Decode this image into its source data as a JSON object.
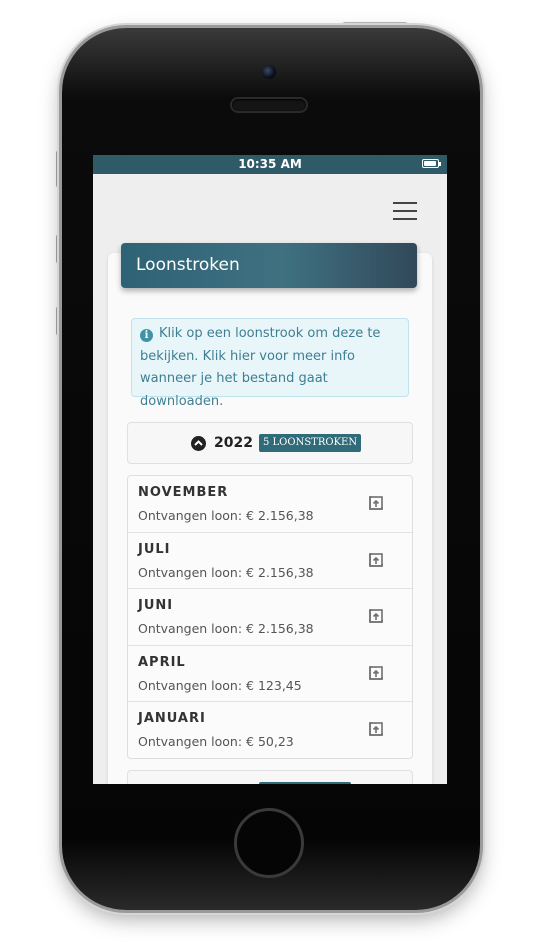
{
  "status_bar": {
    "time": "10:35 AM",
    "battery_level": 0.9
  },
  "header": {
    "menu_icon": "hamburger-menu-icon"
  },
  "card": {
    "title": "Loonstroken"
  },
  "info": {
    "icon": "info-circle-icon",
    "text": "Klik op een loonstrook om deze te bekijken. Klik hier voor meer info wanneer je het bestand gaat downloaden."
  },
  "year_group": {
    "icon": "chevron-up-circle-icon",
    "year": "2022",
    "badge": "5 LOONSTROKEN"
  },
  "payslips": [
    {
      "month": "NOVEMBER",
      "salary": "Ontvangen loon: € 2.156,38",
      "icon": "open-external-icon"
    },
    {
      "month": "JULI",
      "salary": "Ontvangen loon: € 2.156,38",
      "icon": "open-external-icon"
    },
    {
      "month": "JUNI",
      "salary": "Ontvangen loon: € 2.156,38",
      "icon": "open-external-icon"
    },
    {
      "month": "APRIL",
      "salary": "Ontvangen loon: € 123,45",
      "icon": "open-external-icon"
    },
    {
      "month": "JANUARI",
      "salary": "Ontvangen loon: € 50,23",
      "icon": "open-external-icon"
    }
  ],
  "colors": {
    "accent": "#2f6b79",
    "info_bg": "#e8f5f9",
    "info_text": "#3e7f93",
    "status_bar": "#2f5a68"
  }
}
